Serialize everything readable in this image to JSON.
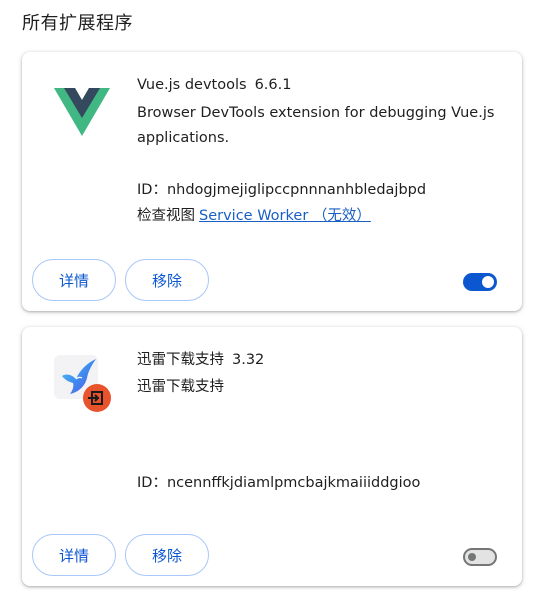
{
  "page": {
    "section_title": "所有扩展程序"
  },
  "extensions": [
    {
      "name": "Vue.js devtools",
      "version": "6.6.1",
      "description": "Browser DevTools extension for debugging Vue.js applications.",
      "id_label": "ID：",
      "id": "nhdogjmejiglipccpnnnanhbledajbpd",
      "inspect_label": "检查视图",
      "inspect_link": "Service Worker （无效）",
      "details_label": "详情",
      "remove_label": "移除",
      "enabled": true,
      "icon": "vue-logo-icon"
    },
    {
      "name": "迅雷下载支持",
      "version": "3.32",
      "description": "迅雷下载支持",
      "id_label": "ID：",
      "id": "ncennffkjdiamlpmcbajkmaiiiddgioo",
      "details_label": "详情",
      "remove_label": "移除",
      "enabled": false,
      "icon": "thunder-bird-icon",
      "badge_icon": "disabled-badge-icon"
    }
  ],
  "colors": {
    "accent": "#0b57d0",
    "link": "#1a5fc5",
    "button_border": "#a8c7fa",
    "vue_green": "#41b883",
    "vue_dark": "#35495e",
    "badge_orange": "#e8532b"
  }
}
